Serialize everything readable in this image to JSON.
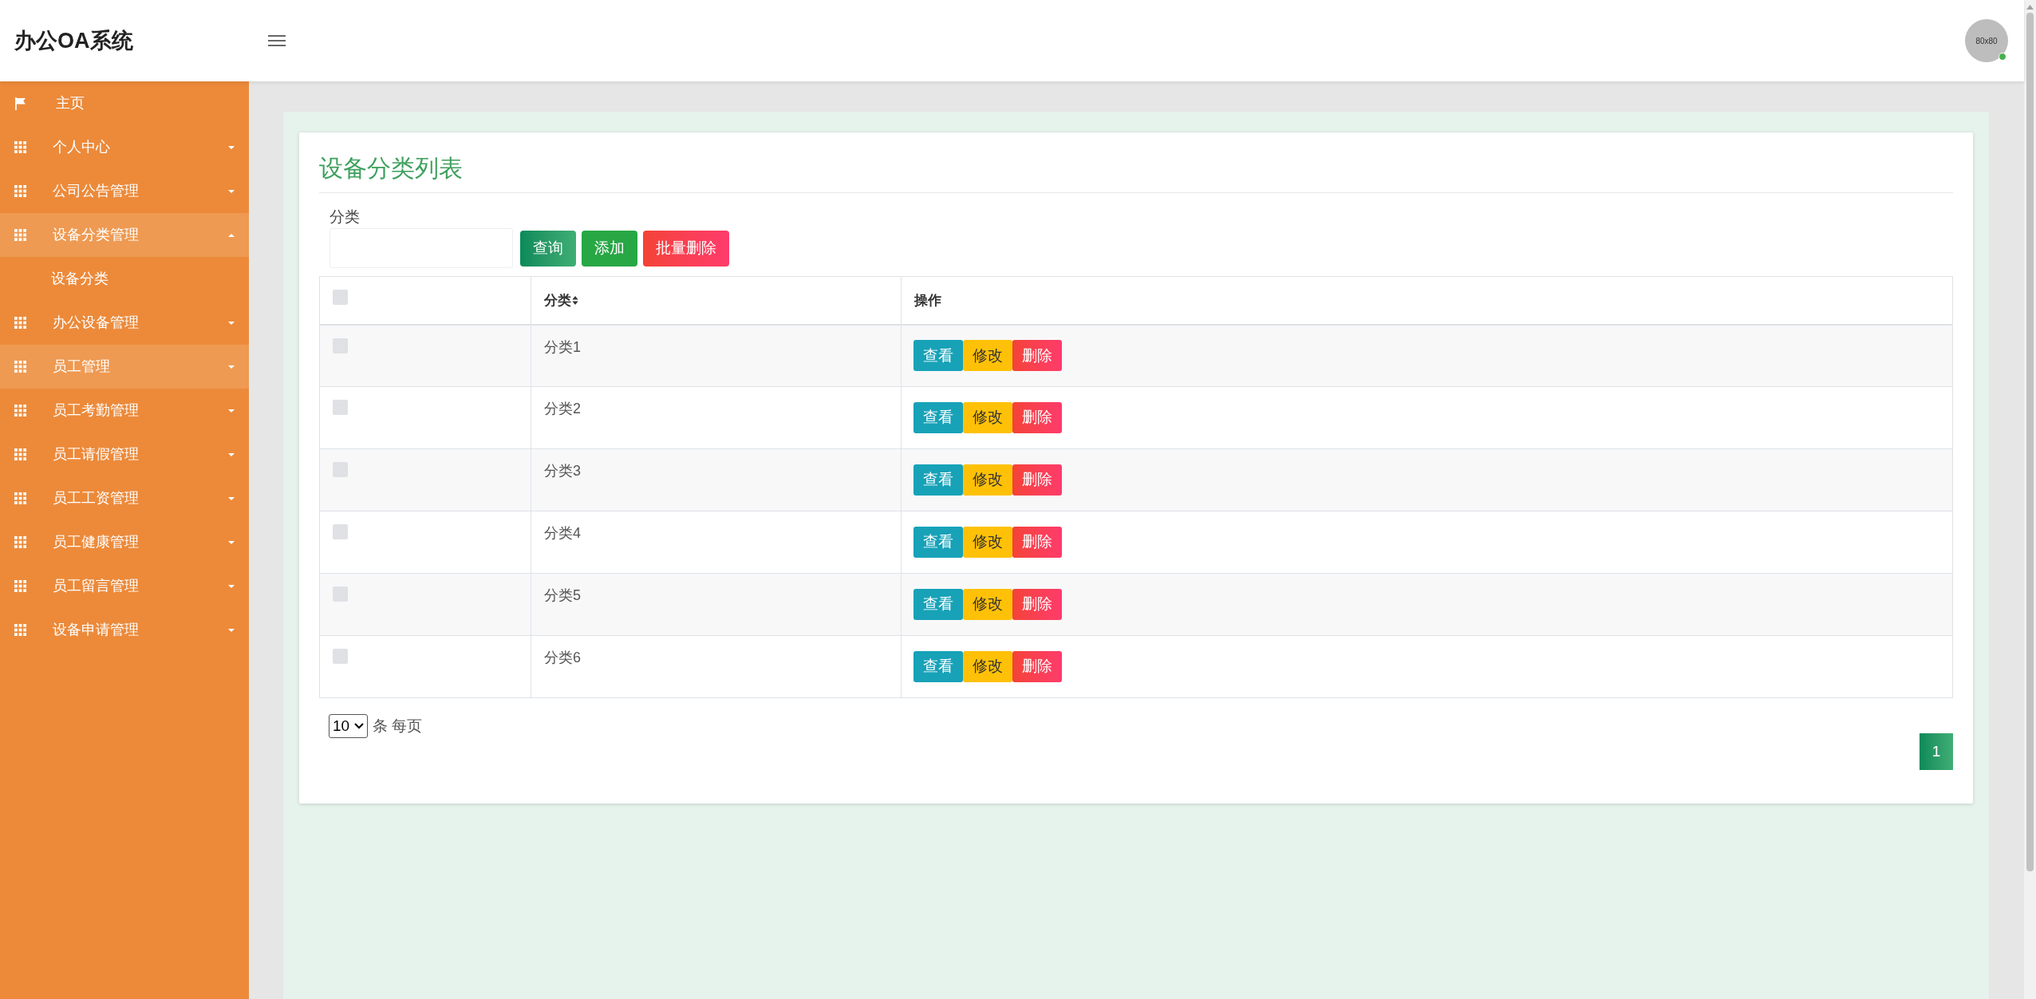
{
  "header": {
    "title": "办公OA系统",
    "avatar_text": "80x80",
    "online": true
  },
  "sidebar": {
    "items": [
      {
        "kind": "link",
        "label": "主页",
        "highlighted": false
      },
      {
        "kind": "group",
        "label": "个人中心",
        "expanded": false,
        "highlighted": false
      },
      {
        "kind": "group",
        "label": "公司公告管理",
        "expanded": false,
        "highlighted": false
      },
      {
        "kind": "group",
        "label": "设备分类管理",
        "expanded": true,
        "highlighted": true,
        "children": [
          {
            "label": "设备分类"
          }
        ]
      },
      {
        "kind": "group",
        "label": "办公设备管理",
        "expanded": false,
        "highlighted": false
      },
      {
        "kind": "group",
        "label": "员工管理",
        "expanded": false,
        "highlighted": true
      },
      {
        "kind": "group",
        "label": "员工考勤管理",
        "expanded": false,
        "highlighted": false
      },
      {
        "kind": "group",
        "label": "员工请假管理",
        "expanded": false,
        "highlighted": false
      },
      {
        "kind": "group",
        "label": "员工工资管理",
        "expanded": false,
        "highlighted": false
      },
      {
        "kind": "group",
        "label": "员工健康管理",
        "expanded": false,
        "highlighted": false
      },
      {
        "kind": "group",
        "label": "员工留言管理",
        "expanded": false,
        "highlighted": false
      },
      {
        "kind": "group",
        "label": "设备申请管理",
        "expanded": false,
        "highlighted": false
      }
    ]
  },
  "page": {
    "title": "设备分类列表",
    "search": {
      "label": "分类",
      "buttons": [
        {
          "label": "查询",
          "kind": "query"
        },
        {
          "label": "添加",
          "kind": "add"
        },
        {
          "label": "批量删除",
          "kind": "batch-delete"
        }
      ]
    },
    "table": {
      "select_all_checked": false,
      "columns": [
        {
          "label": "分类",
          "sortable": true
        },
        {
          "label": "操作",
          "sortable": false
        }
      ],
      "rows": [
        {
          "checked": false,
          "name": "分类1",
          "actions": [
            {
              "label": "查看",
              "kind": "view"
            },
            {
              "label": "修改",
              "kind": "edit"
            },
            {
              "label": "删除",
              "kind": "delete"
            }
          ]
        },
        {
          "checked": false,
          "name": "分类2",
          "actions": [
            {
              "label": "查看",
              "kind": "view"
            },
            {
              "label": "修改",
              "kind": "edit"
            },
            {
              "label": "删除",
              "kind": "delete"
            }
          ]
        },
        {
          "checked": false,
          "name": "分类3",
          "actions": [
            {
              "label": "查看",
              "kind": "view"
            },
            {
              "label": "修改",
              "kind": "edit"
            },
            {
              "label": "删除",
              "kind": "delete"
            }
          ]
        },
        {
          "checked": false,
          "name": "分类4",
          "actions": [
            {
              "label": "查看",
              "kind": "view"
            },
            {
              "label": "修改",
              "kind": "edit"
            },
            {
              "label": "删除",
              "kind": "delete"
            }
          ]
        },
        {
          "checked": false,
          "name": "分类5",
          "actions": [
            {
              "label": "查看",
              "kind": "view"
            },
            {
              "label": "修改",
              "kind": "edit"
            },
            {
              "label": "删除",
              "kind": "delete"
            }
          ]
        },
        {
          "checked": false,
          "name": "分类6",
          "actions": [
            {
              "label": "查看",
              "kind": "view"
            },
            {
              "label": "修改",
              "kind": "edit"
            },
            {
              "label": "删除",
              "kind": "delete"
            }
          ]
        }
      ]
    },
    "pagination": {
      "page_size": "10",
      "page_size_suffix": "条 每页",
      "pages": [
        {
          "label": "1",
          "selected": true
        }
      ]
    }
  }
}
